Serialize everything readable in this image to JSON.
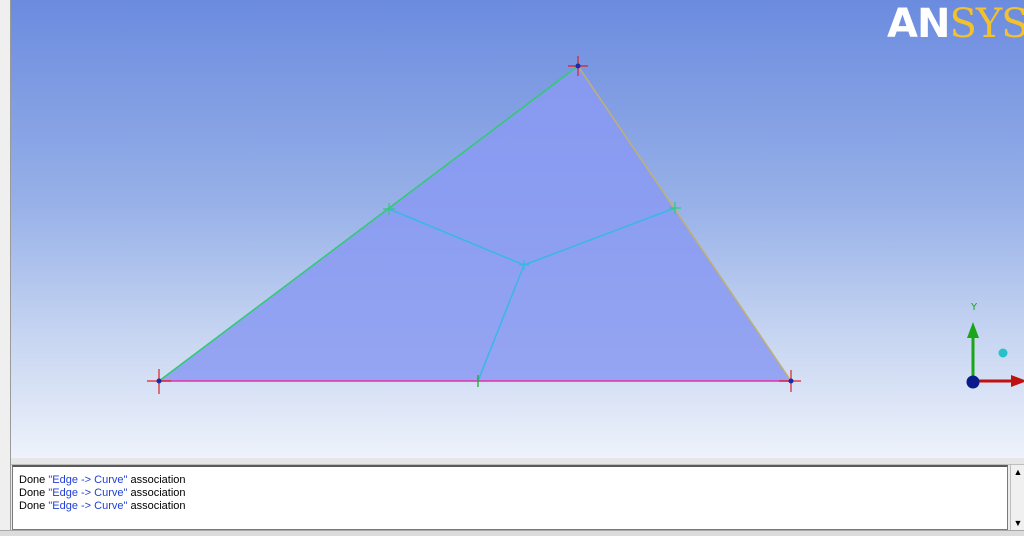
{
  "app": {
    "logo_primary": "AN",
    "logo_secondary": "SYS",
    "logo_primary_color": "#ffffff",
    "logo_secondary_color": "#f3c12a"
  },
  "viewport": {
    "face_fill": "#8a9af2",
    "edge_colors": {
      "left": "#2ecc71",
      "right": "#c0b070",
      "bottom": "#e62ea8",
      "internal": "#3ab6e8"
    },
    "axis": {
      "y_label": "Y",
      "y_color": "#1aa51a",
      "x_color": "#c01010",
      "origin_color": "#0a1a8a",
      "z_color": "#27c1c9"
    }
  },
  "messages": [
    {
      "prefix": "Done ",
      "highlight": "\"Edge -> Curve\"",
      "suffix": " association"
    },
    {
      "prefix": "Done ",
      "highlight": "\"Edge -> Curve\"",
      "suffix": " association"
    },
    {
      "prefix": "Done ",
      "highlight": "\"Edge -> Curve\"",
      "suffix": " association"
    }
  ],
  "scrollbar": {
    "up_glyph": "▲",
    "down_glyph": "▼"
  }
}
